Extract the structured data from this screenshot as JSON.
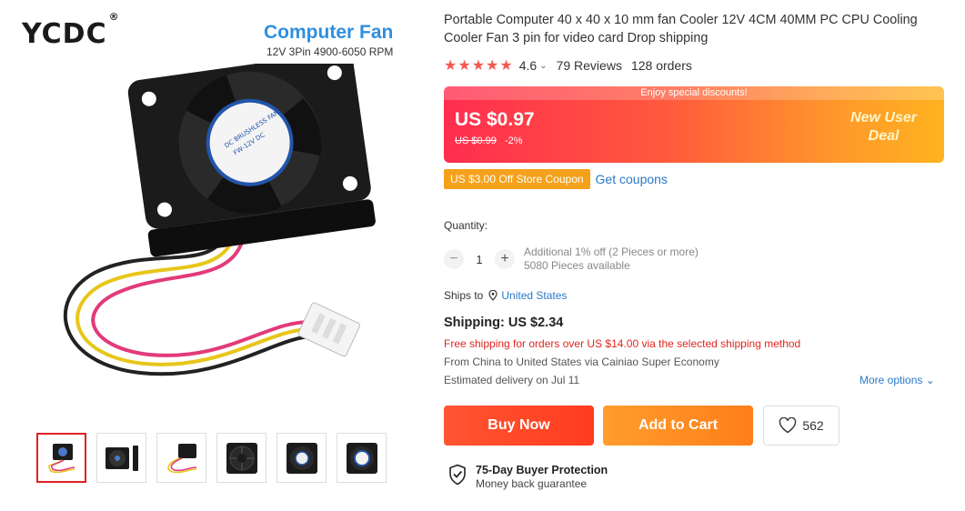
{
  "gallery": {
    "brand": "YCDC",
    "brand_mark": "®",
    "promo_title": "Computer Fan",
    "promo_subtitle": "12V 3Pin 4900-6050 RPM",
    "fan_label_line1": "DC BRUSHLESS FAN",
    "fan_label_line2": "FW-12V DC",
    "thumbnails": [
      "thumb-1",
      "thumb-2",
      "thumb-3",
      "thumb-4",
      "thumb-5",
      "thumb-6"
    ],
    "active_thumbnail": 0
  },
  "product": {
    "title": "Portable Computer 40 x 40 x 10 mm fan Cooler 12V 4CM 40MM PC CPU Cooling Cooler Fan 3 pin for video card Drop shipping",
    "stars": "★★★★★",
    "rating": "4.6",
    "rating_chevron": "⌄",
    "reviews": "79 Reviews",
    "orders": "128 orders"
  },
  "price": {
    "banner_top": "Enjoy special discounts!",
    "current": "US $0.97",
    "original": "US $0.99",
    "discount": "-2%",
    "new_user_line1": "New User",
    "new_user_line2": "Deal"
  },
  "coupon": {
    "tag": "US $3.00 Off Store Coupon",
    "link": "Get coupons"
  },
  "quantity": {
    "label": "Quantity:",
    "minus": "−",
    "value": "1",
    "plus": "+",
    "additional": "Additional 1% off (2 Pieces or more)",
    "available": "5080 Pieces available"
  },
  "shipping": {
    "ships_to_label": "Ships to",
    "ships_to_country": "United States",
    "title": "Shipping: US $2.34",
    "free_note": "Free shipping for orders over US $14.00 via the selected shipping method",
    "from": "From China to United States via Cainiao Super Economy",
    "estimate": "Estimated delivery on Jul 11",
    "more_options": "More options ⌄"
  },
  "actions": {
    "buy_now": "Buy Now",
    "add_to_cart": "Add to Cart",
    "wishlist_count": "562"
  },
  "protection": {
    "title": "75-Day Buyer Protection",
    "subtitle": "Money back guarantee"
  },
  "colors": {
    "accent_red": "#ff3c1f",
    "accent_orange": "#ff7e1a",
    "link_blue": "#2a7ac8",
    "star_red": "#f25a50"
  }
}
